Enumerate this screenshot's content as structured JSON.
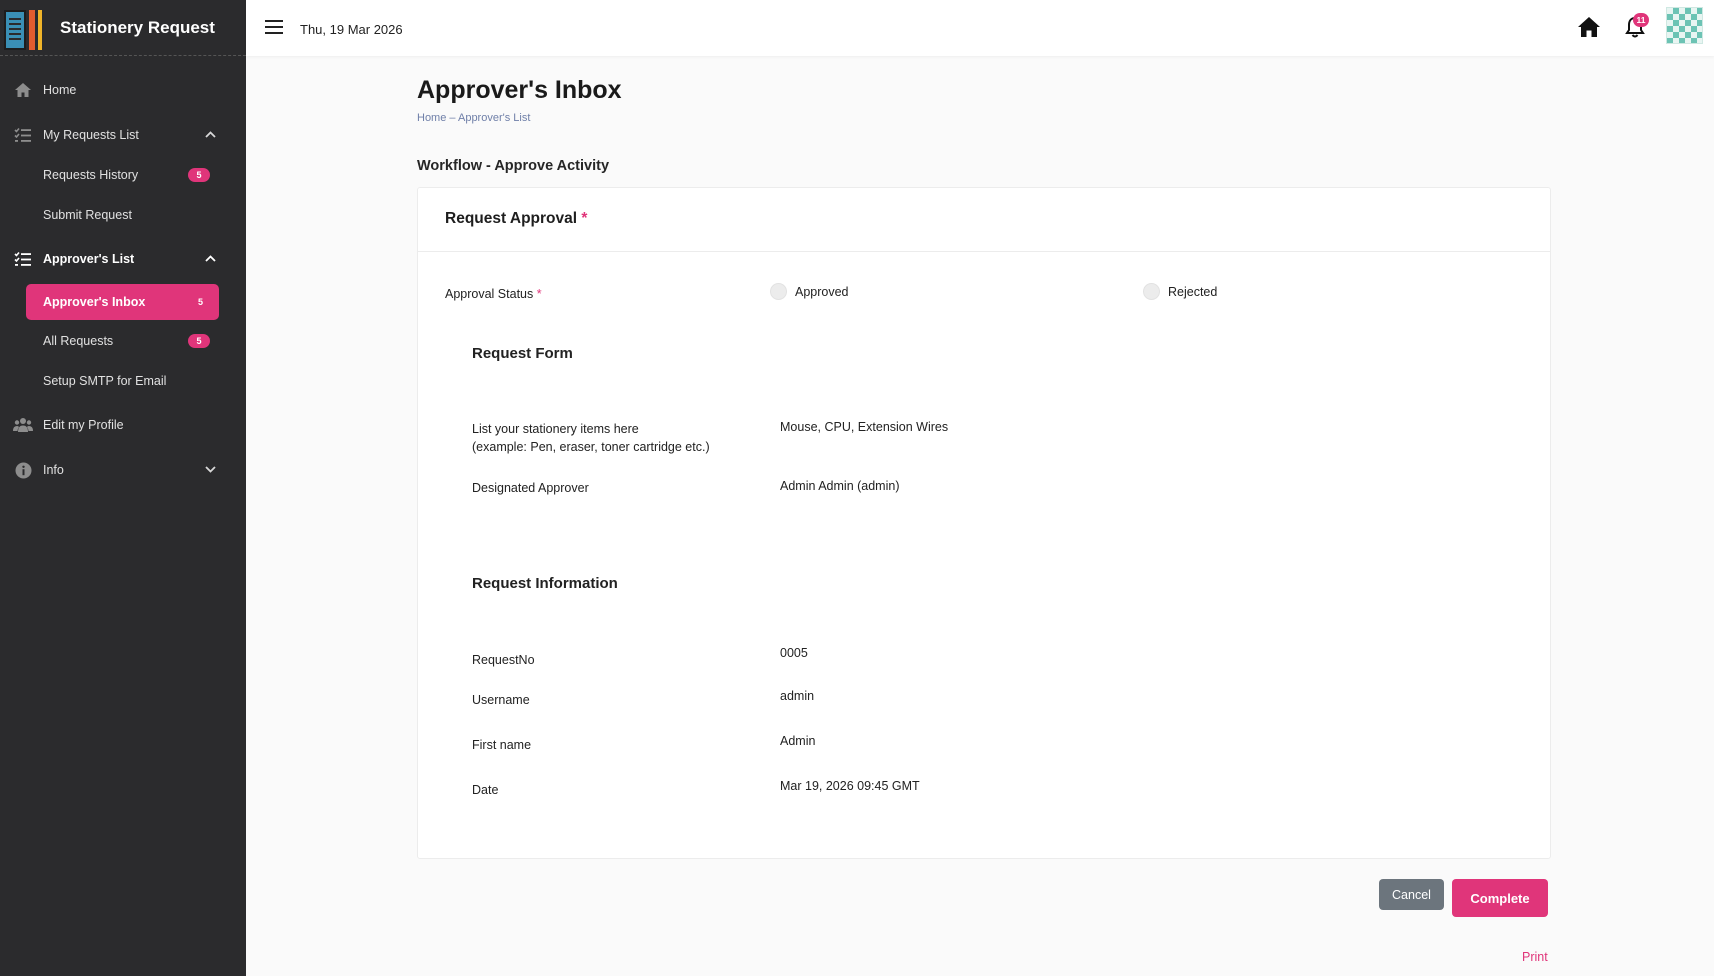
{
  "app": {
    "title": "Stationery Request"
  },
  "sidebar": {
    "items": [
      {
        "label": "Home",
        "icon": "home-icon"
      },
      {
        "label": "My Requests List",
        "icon": "list-check-icon",
        "expanded": true
      },
      {
        "label": "Requests History",
        "badge": "5"
      },
      {
        "label": "Submit Request"
      },
      {
        "label": "Approver's List",
        "icon": "list-check-icon",
        "expanded": true
      },
      {
        "label": "Approver's Inbox",
        "badge": "5",
        "active": true
      },
      {
        "label": "All Requests",
        "badge": "5"
      },
      {
        "label": "Setup SMTP for Email"
      },
      {
        "label": "Edit my Profile",
        "icon": "users-icon"
      },
      {
        "label": "Info",
        "icon": "info-icon",
        "expanded": false
      }
    ]
  },
  "topbar": {
    "date": "Thu, 19 Mar 2026",
    "notification_count": "11"
  },
  "page": {
    "title": "Approver's Inbox",
    "breadcrumb": {
      "home": "Home",
      "separator": "–",
      "current": "Approver's List"
    },
    "workflow": "Workflow - Approve Activity"
  },
  "card": {
    "title": "Request Approval",
    "required_mark": "*",
    "approval_status": {
      "label": "Approval Status",
      "options": [
        "Approved",
        "Rejected"
      ],
      "selected": null
    },
    "request_form": {
      "heading": "Request Form",
      "items_label_line1": "List your stationery items here",
      "items_label_line2": "(example: Pen, eraser, toner cartridge etc.)",
      "items_value": "Mouse, CPU, Extension Wires",
      "approver_label": "Designated Approver",
      "approver_value": "Admin Admin (admin)"
    },
    "request_information": {
      "heading": "Request Information",
      "fields": [
        {
          "label": "RequestNo",
          "value": "0005"
        },
        {
          "label": "Username",
          "value": "admin"
        },
        {
          "label": "First name",
          "value": "Admin"
        },
        {
          "label": "Date",
          "value": "Mar 19, 2026 09:45 GMT"
        }
      ]
    }
  },
  "actions": {
    "cancel": "Cancel",
    "complete": "Complete",
    "print": "Print"
  },
  "colors": {
    "accent": "#e0357a",
    "sidebar": "#2b2b2d",
    "cancel": "#6c757d"
  }
}
